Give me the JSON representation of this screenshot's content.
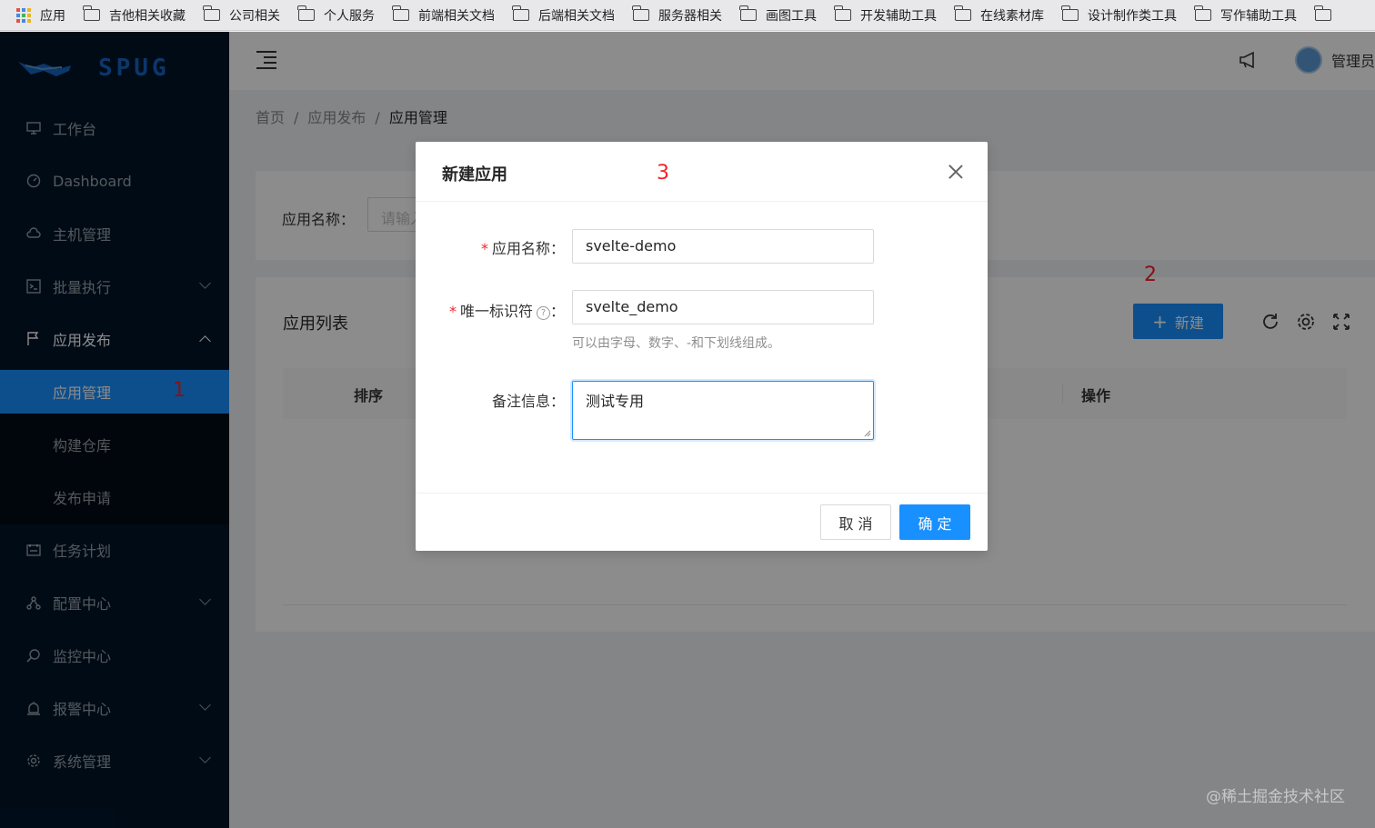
{
  "bookmarks": {
    "apps_label": "应用",
    "folders": [
      "吉他相关收藏",
      "公司相关",
      "个人服务",
      "前端相关文档",
      "后端相关文档",
      "服务器相关",
      "画图工具",
      "开发辅助工具",
      "在线素材库",
      "设计制作类工具",
      "写作辅助工具"
    ]
  },
  "logo": {
    "text": "SPUG"
  },
  "sidebar": {
    "items": [
      {
        "label": "工作台",
        "icon": "desktop-icon"
      },
      {
        "label": "Dashboard",
        "icon": "dashboard-icon"
      },
      {
        "label": "主机管理",
        "icon": "cloud-server-icon"
      },
      {
        "label": "批量执行",
        "icon": "code-icon"
      },
      {
        "label": "应用发布",
        "icon": "flag-icon"
      },
      {
        "label": "应用管理"
      },
      {
        "label": "构建仓库"
      },
      {
        "label": "发布申请"
      },
      {
        "label": "任务计划",
        "icon": "schedule-icon"
      },
      {
        "label": "配置中心",
        "icon": "deployment-icon"
      },
      {
        "label": "监控中心",
        "icon": "monitor-icon"
      },
      {
        "label": "报警中心",
        "icon": "alert-icon"
      },
      {
        "label": "系统管理",
        "icon": "setting-icon"
      }
    ]
  },
  "annotations": {
    "one": "1",
    "two": "2",
    "three": "3"
  },
  "header": {
    "user_name": "管理员"
  },
  "breadcrumb": {
    "home": "首页",
    "parent": "应用发布",
    "current": "应用管理",
    "sep": "/"
  },
  "search": {
    "label": "应用名称：",
    "placeholder": "请输入"
  },
  "list": {
    "title": "应用列表",
    "new_button": "新建",
    "columns": {
      "order": "排序",
      "actions": "操作"
    }
  },
  "modal": {
    "title": "新建应用",
    "fields": {
      "name_label": "应用名称：",
      "name_value": "svelte-demo",
      "key_label": "唯一标识符",
      "key_colon": "：",
      "key_value": "svelte_demo",
      "key_help": "可以由字母、数字、-和下划线组成。",
      "desc_label": "备注信息：",
      "desc_value": "测试专用"
    },
    "required_mark": "*",
    "cancel": "取 消",
    "ok": "确 定"
  },
  "watermark": "@稀土掘金技术社区",
  "colors": {
    "primary": "#1890ff",
    "sidebar": "#001529",
    "annotation": "#f5222d"
  }
}
